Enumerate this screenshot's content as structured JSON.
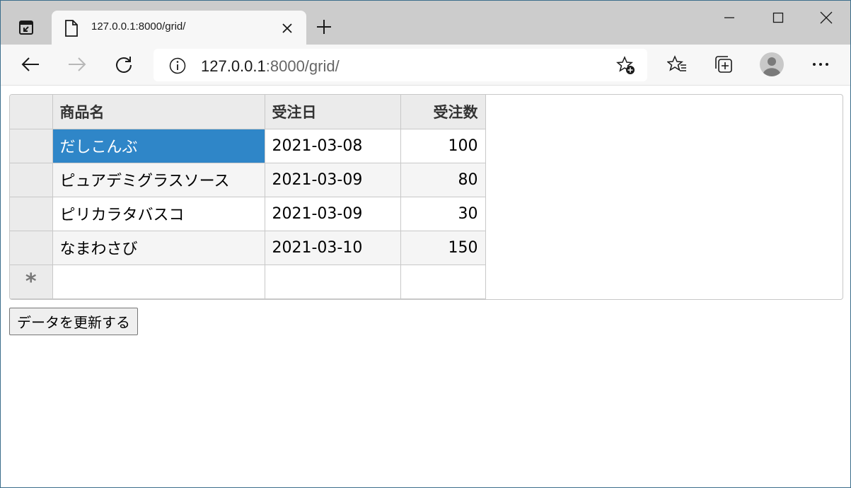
{
  "browser": {
    "tab_title": "127.0.0.1:8000/grid/",
    "url_host": "127.0.0.1",
    "url_path": ":8000/grid/"
  },
  "grid": {
    "columns": [
      "商品名",
      "受注日",
      "受注数"
    ],
    "rows": [
      {
        "name": "だしこんぶ",
        "date": "2021-03-08",
        "qty": "100"
      },
      {
        "name": "ピュアデミグラスソース",
        "date": "2021-03-09",
        "qty": "80"
      },
      {
        "name": "ピリカラタバスコ",
        "date": "2021-03-09",
        "qty": "30"
      },
      {
        "name": "なまわさび",
        "date": "2021-03-10",
        "qty": "150"
      }
    ],
    "new_row_marker": "*",
    "selected_cell": "だしこんぶ",
    "selected_color": "#2f86c8"
  },
  "update_button_label": "データを更新する",
  "icons": {
    "tab_actions": "tab-actions-icon",
    "page": "page-icon",
    "close": "close-icon",
    "new_tab": "plus-icon",
    "back": "back-arrow-icon",
    "forward": "forward-arrow-icon",
    "refresh": "refresh-icon",
    "info": "info-icon",
    "add_favorite": "add-favorite-icon",
    "favorites": "favorites-icon",
    "collections": "collections-icon",
    "profile": "profile-avatar-icon",
    "more": "more-icon",
    "minimize": "minimize-icon",
    "maximize": "maximize-icon",
    "window_close": "window-close-icon"
  }
}
